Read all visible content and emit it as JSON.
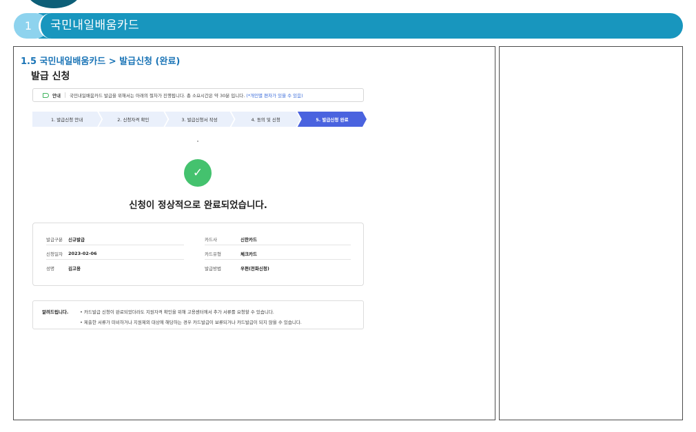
{
  "section": {
    "number": "1",
    "title": "국민내일배움카드"
  },
  "breadcrumb": "1.5 국민내일배움카드 > 발급신청 (완료)",
  "page_title": "발급 신청",
  "notice": {
    "label": "안내",
    "text": "국민내일배움카드 발급을 위해서는 아래의 절차가 진행됩니다. 총 소요시간은 약 30분 입니다.",
    "highlight": "(*개인별 편차가 있을 수 있음)"
  },
  "steps": [
    {
      "label": "1. 발급신청 안내"
    },
    {
      "label": "2. 신청자격 확인"
    },
    {
      "label": "3. 발급신청서 작성"
    },
    {
      "label": "4. 동의 및 신청"
    },
    {
      "label": "5. 발급신청 완료"
    }
  ],
  "check_icon": "✓",
  "complete_message": "신청이 정상적으로 완료되었습니다.",
  "info": {
    "issue_type_label": "발급구분",
    "issue_type_value": "신규발급",
    "card_company_label": "카드사",
    "card_company_value": "신한카드",
    "apply_date_label": "신청일자",
    "apply_date_value": "2023-02-06",
    "card_type_label": "카드유형",
    "card_type_value": "체크카드",
    "name_label": "성명",
    "name_value": "김고용",
    "issue_method_label": "발급방법",
    "issue_method_value": "우편(전화신청)"
  },
  "notes": {
    "heading": "알려드립니다.",
    "items": [
      "• 카드발급 신청이 완료되었더라도 지원자격 확인을 위해 고용센터에서 추가 서류를 요청할 수 있습니다.",
      "• 제출한 서류가 미비하거나 지원제외 대상에 해당하는 경우 카드발급이 보류되거나 카드발급이 되지 않을 수 있습니다."
    ]
  },
  "colors": {
    "section_bar": "#1896be",
    "section_number": "#8ed3ee",
    "breadcrumb": "#1a74b6",
    "active_step": "#4a63df",
    "inactive_step": "#eaf0fb",
    "success": "#44c26e",
    "notice_highlight": "#3668d9"
  }
}
